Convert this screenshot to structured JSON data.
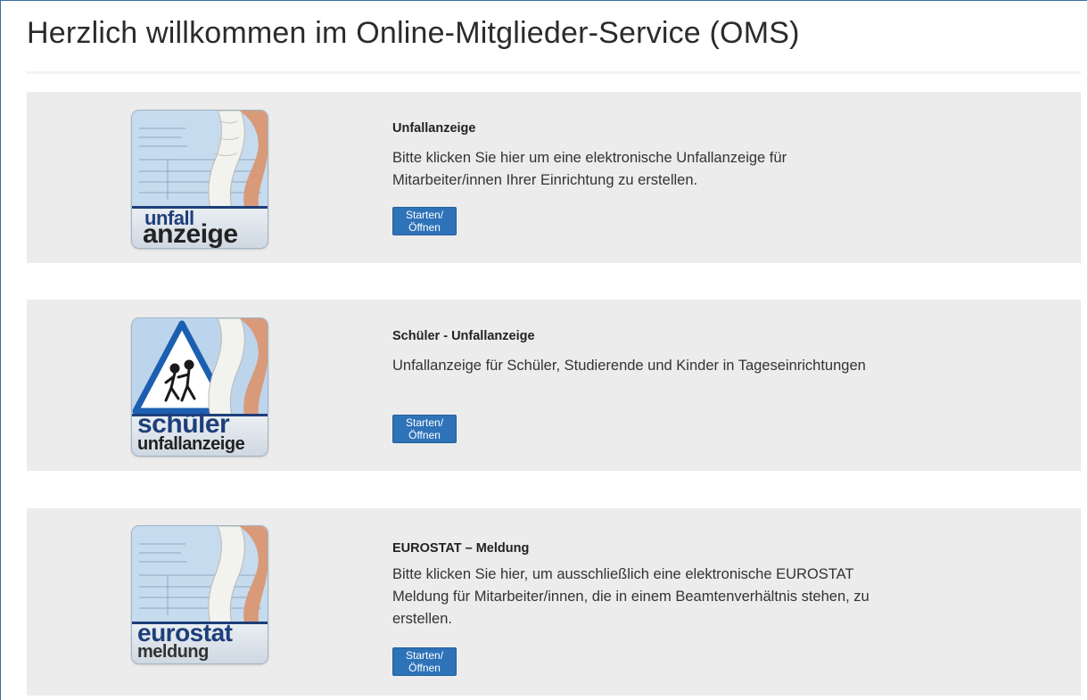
{
  "page": {
    "title": "Herzlich willkommen im Online-Mitglieder-Service (OMS)"
  },
  "colors": {
    "accent_button": "#2e72b8",
    "card_background": "#ececec",
    "thumbnail_band": "#1e3f7a"
  },
  "services": [
    {
      "title": "Unfallanzeige",
      "description": "Bitte klicken Sie hier um eine elektronische Unfallanzeige für Mitarbeiter/innen Ihrer Einrichtung zu erstellen.",
      "button_label": "Starten/Öffnen",
      "thumbnail": {
        "line1": "unfall",
        "line2": "anzeige",
        "icon": "injured-leg-form-icon"
      }
    },
    {
      "title": "Schüler - Unfallanzeige",
      "description": "Unfallanzeige für Schüler, Studierende und Kinder in Tageseinrichtungen",
      "button_label": "Starten/Öffnen",
      "thumbnail": {
        "line1": "schüler",
        "line2": "unfallanzeige",
        "icon": "school-sign-injured-leg-icon"
      }
    },
    {
      "title": "EUROSTAT – Meldung",
      "description": "Bitte klicken Sie hier, um ausschließlich eine elektronische EUROSTAT Meldung für Mitarbeiter/innen, die in einem Beamtenverhältnis stehen, zu erstellen.",
      "button_label": "Starten/Öffnen",
      "thumbnail": {
        "line1": "eurostat",
        "line2": "meldung",
        "icon": "injured-leg-form-icon"
      }
    }
  ]
}
